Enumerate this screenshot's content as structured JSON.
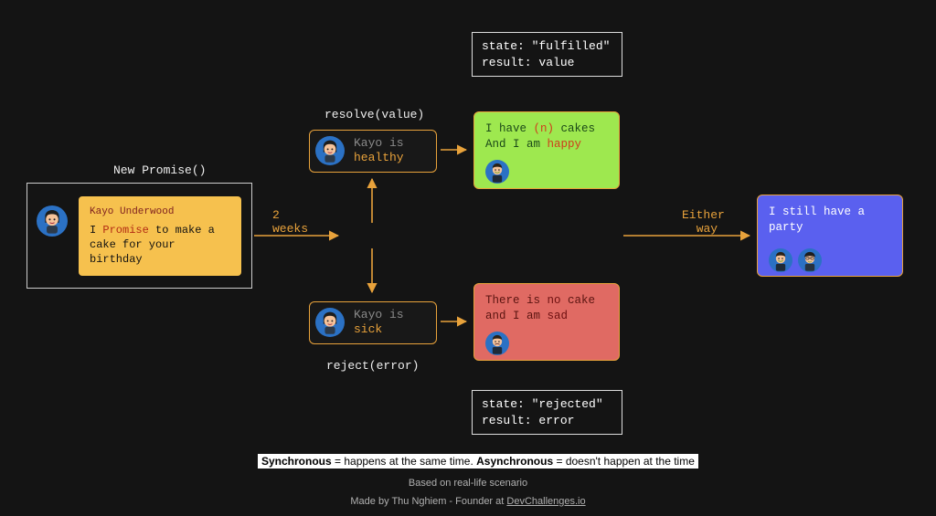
{
  "labels": {
    "new_promise": "New Promise()",
    "resolve": "resolve(value)",
    "reject": "reject(error)",
    "two_weeks_1": "2",
    "two_weeks_2": "weeks",
    "either_1": "Either",
    "either_2": "way"
  },
  "promise": {
    "author": "Kayo Underwood",
    "t1": "I ",
    "hl": "Promise",
    "t2": " to make a cake for your birthday"
  },
  "status": {
    "healthy_prefix": "Kayo is ",
    "healthy_value": "healthy",
    "sick_prefix": "Kayo is ",
    "sick_value": "sick"
  },
  "resolve_card": {
    "l1a": "I have ",
    "l1hl": "(n)",
    "l1b": " cakes",
    "l2a": "And I am ",
    "l2hl": "happy"
  },
  "reject_card": {
    "l1a": "There is ",
    "l1hl": "no",
    "l1b": " cake",
    "l2a": "and I am ",
    "l2hl": "sad"
  },
  "final_card": {
    "line": "I still have a party"
  },
  "state_fulfilled": {
    "l1": "state: \"fulfilled\"",
    "l2": "result: value"
  },
  "state_rejected": {
    "l1": "state: \"rejected\"",
    "l2": "result: error"
  },
  "footer": {
    "sync_label": "Synchronous",
    "sync_text": " = happens at the same time. ",
    "async_label": "Asynchronous",
    "async_text": " = doesn't happen at the time",
    "based": "Based on real-life scenario",
    "made_prefix": "Made by Thu Nghiem - Founder at ",
    "made_link": "DevChallenges.io"
  }
}
